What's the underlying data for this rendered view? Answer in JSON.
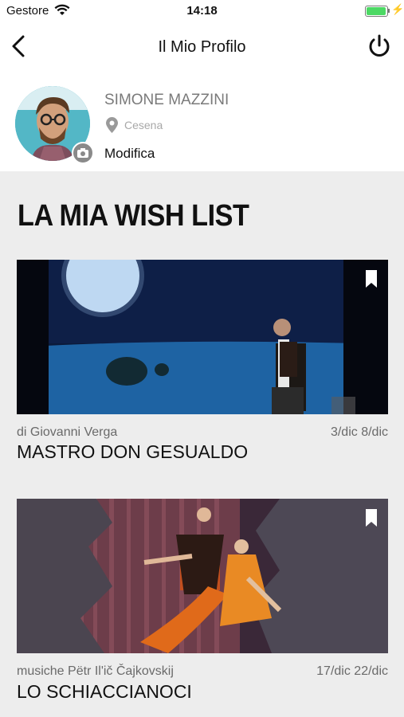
{
  "status": {
    "carrier": "Gestore",
    "time": "14:18",
    "battery_color": "#4cd964"
  },
  "nav": {
    "title": "Il Mio Profilo",
    "back_icon": "chevron-left-icon",
    "power_icon": "power-icon"
  },
  "profile": {
    "name": "SIMONE MAZZINI",
    "city": "Cesena",
    "edit_label": "Modifica",
    "avatar_bg": "#4fb3c3"
  },
  "wishlist": {
    "heading": "LA MIA WISH LIST",
    "items": [
      {
        "author": "di Giovanni Verga",
        "dates": "3/dic 8/dic",
        "title": "MASTRO DON GESUALDO",
        "bookmark_icon": "bookmark-icon"
      },
      {
        "author": "musiche Pëtr Il'ič Čajkovskij",
        "dates": "17/dic 22/dic",
        "title": "LO SCHIACCIANOCI",
        "bookmark_icon": "bookmark-icon"
      }
    ]
  }
}
